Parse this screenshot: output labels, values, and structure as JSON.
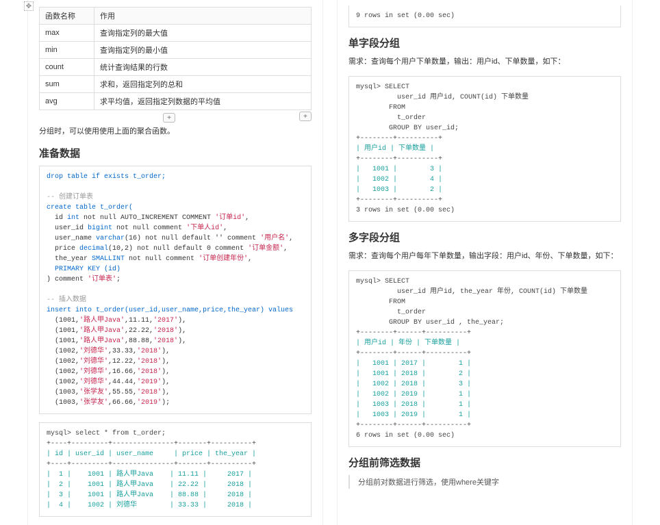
{
  "left": {
    "func_table": {
      "headers": [
        "函数名称",
        "作用"
      ],
      "rows": [
        [
          "max",
          "查询指定列的最大值"
        ],
        [
          "min",
          "查询指定列的最小值"
        ],
        [
          "count",
          "统计查询结果的行数"
        ],
        [
          "sum",
          "求和，返回指定列的总和"
        ],
        [
          "avg",
          "求平均值，返回指定列数据的平均值"
        ]
      ]
    },
    "note_after_table": "分组时，可以使用使用上面的聚合函数。",
    "h_prepare": "准备数据",
    "code_prepare": {
      "l01": "drop table if exists t_order;",
      "l02": "-- 创建订单表",
      "l03a": "create table t_order(",
      "l04a": "  id ",
      "l04b": "int",
      "l04c": " not null AUTO_INCREMENT COMMENT ",
      "l04d": "'订单id'",
      "l04e": ",",
      "l05a": "  user_id ",
      "l05b": "bigint",
      "l05c": " not null comment ",
      "l05d": "'下单人id'",
      "l05e": ",",
      "l06a": "  user_name ",
      "l06b": "varchar",
      "l06c": "(16) not null default '' comment ",
      "l06d": "'用户名'",
      "l06e": ",",
      "l07a": "  price ",
      "l07b": "decimal",
      "l07c": "(10,2) not null default 0 comment ",
      "l07d": "'订单金额'",
      "l07e": ",",
      "l08a": "  the_year ",
      "l08b": "SMALLINT",
      "l08c": " not null comment ",
      "l08d": "'订单创建年份'",
      "l08e": ",",
      "l09": "  PRIMARY KEY (id)",
      "l10a": ") comment ",
      "l10b": "'订单表'",
      "l10c": ";",
      "l11": "-- 插入数据",
      "l12": "insert into t_order(user_id,user_name,price,the_year) values",
      "r1a": "  (1001,",
      "r1b": "'路人甲Java'",
      "r1c": ",11.11,",
      "r1d": "'2017'",
      "r1e": "),",
      "r2a": "  (1001,",
      "r2b": "'路人甲Java'",
      "r2c": ",22.22,",
      "r2d": "'2018'",
      "r2e": "),",
      "r3a": "  (1001,",
      "r3b": "'路人甲Java'",
      "r3c": ",88.88,",
      "r3d": "'2018'",
      "r3e": "),",
      "r4a": "  (1002,",
      "r4b": "'刘德华'",
      "r4c": ",33.33,",
      "r4d": "'2018'",
      "r4e": "),",
      "r5a": "  (1002,",
      "r5b": "'刘德华'",
      "r5c": ",12.22,",
      "r5d": "'2018'",
      "r5e": "),",
      "r6a": "  (1002,",
      "r6b": "'刘德华'",
      "r6c": ",16.66,",
      "r6d": "'2018'",
      "r6e": "),",
      "r7a": "  (1002,",
      "r7b": "'刘德华'",
      "r7c": ",44.44,",
      "r7d": "'2019'",
      "r7e": "),",
      "r8a": "  (1003,",
      "r8b": "'张学友'",
      "r8c": ",55.55,",
      "r8d": "'2018'",
      "r8e": "),",
      "r9a": "  (1003,",
      "r9b": "'张学友'",
      "r9c": ",66.66,",
      "r9d": "'2019'",
      "r9e": ");"
    },
    "select_all": {
      "l1": "mysql> select * from t_order;",
      "sep": "+----+---------+---------------+-------+----------+",
      "hdr": "| id | user_id | user_name     | price | the_year |",
      "rows": [
        "|  1 |    1001 | 路人甲Java    | 11.11 |     2017 |",
        "|  2 |    1001 | 路人甲Java    | 22.22 |     2018 |",
        "|  3 |    1001 | 路人甲Java    | 88.88 |     2018 |",
        "|  4 |    1002 | 刘德华        | 33.33 |     2018 |"
      ]
    }
  },
  "right": {
    "top_tail": "9 rows in set (0.00 sec)",
    "h_single": "单字段分组",
    "desc_single": "需求：查询每个用户下单数量，输出：用户id、下单数量，如下：",
    "sql_single": {
      "l1": "mysql> SELECT",
      "l2": "          user_id 用户id, COUNT(id) 下单数量",
      "l3": "        FROM",
      "l4": "          t_order",
      "l5": "        GROUP BY user_id;",
      "sep": "+--------+----------+",
      "hdr": "| 用户id | 下单数量 |",
      "rows": [
        "|   1001 |        3 |",
        "|   1002 |        4 |",
        "|   1003 |        2 |"
      ],
      "foot": "3 rows in set (0.00 sec)"
    },
    "h_multi": "多字段分组",
    "desc_multi": "需求：查询每个用户每年下单数量，输出字段：用户id、年份、下单数量，如下：",
    "sql_multi": {
      "l1": "mysql> SELECT",
      "l2": "          user_id 用户id, the_year 年份, COUNT(id) 下单数量",
      "l3": "        FROM",
      "l4": "          t_order",
      "l5": "        GROUP BY user_id , the_year;",
      "sep": "+--------+------+----------+",
      "hdr": "| 用户id | 年份 | 下单数量 |",
      "rows": [
        "|   1001 | 2017 |        1 |",
        "|   1001 | 2018 |        2 |",
        "|   1002 | 2018 |        3 |",
        "|   1002 | 2019 |        1 |",
        "|   1003 | 2018 |        1 |",
        "|   1003 | 2019 |        1 |"
      ],
      "foot": "6 rows in set (0.00 sec)"
    },
    "h_filter": "分组前筛选数据",
    "quote_filter": "分组前对数据进行筛选，使用where关键字"
  }
}
